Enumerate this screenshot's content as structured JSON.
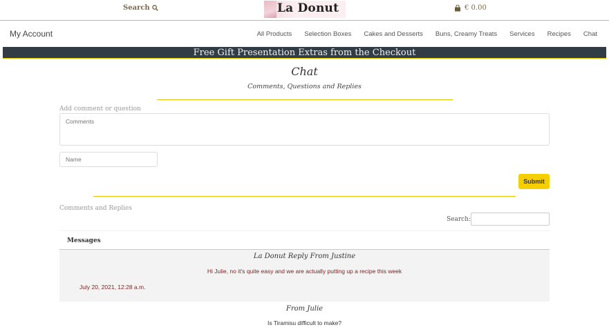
{
  "header": {
    "search_label": "Search",
    "logo_text": "La Donut",
    "cart_total": "€ 0.00"
  },
  "nav": {
    "account": "My Account",
    "items": [
      "All Products",
      "Selection Boxes",
      "Cakes and Desserts",
      "Buns, Creamy Treats",
      "Services",
      "Recipes",
      "Chat"
    ]
  },
  "banner": "Free Gift Presentation Extras from the Checkout",
  "page": {
    "title": "Chat",
    "subtitle": "Comments, Questions and Replies"
  },
  "form": {
    "label": "Add comment or question",
    "comments_placeholder": "Comments",
    "name_placeholder": "Name",
    "submit_label": "Submit"
  },
  "list": {
    "label": "Comments and Replies",
    "search_label": "Search:",
    "header": "Messages",
    "messages": [
      {
        "from": "La Donut Reply From Justine",
        "body": "Hi Julie, no it's quite easy and we are actually putting up a recipe this week",
        "date": "July 20, 2021, 12:28 a.m."
      },
      {
        "from": "From Julie",
        "body": "Is Tiramisu difficult to make?"
      }
    ]
  },
  "colors": {
    "accent": "#f5cf00",
    "banner_bg": "#323c44",
    "message_text": "#7a1f1f"
  }
}
